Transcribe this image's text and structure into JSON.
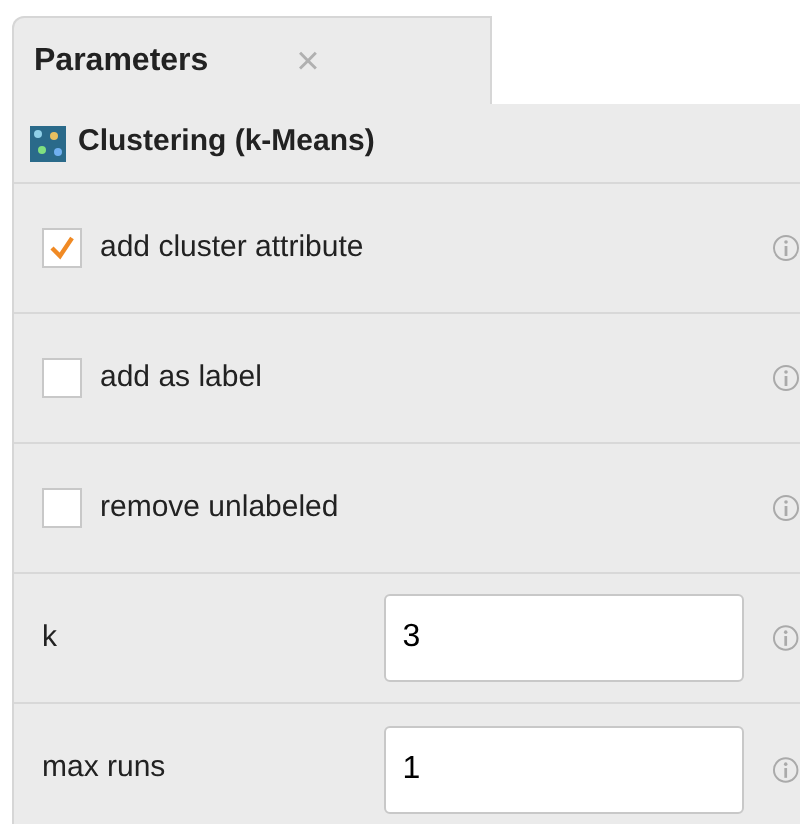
{
  "tabs": [
    {
      "label": "Parameters",
      "close": "×",
      "selected": true
    }
  ],
  "operator": {
    "title": "Clustering (k-Means)"
  },
  "parameters": [
    {
      "kind": "checkbox",
      "label": "add cluster attribute",
      "checked": true
    },
    {
      "kind": "checkbox",
      "label": "add as label",
      "checked": false
    },
    {
      "kind": "checkbox",
      "label": "remove unlabeled",
      "checked": false
    },
    {
      "kind": "number",
      "label": "k",
      "value": "3"
    },
    {
      "kind": "number",
      "label": "max runs",
      "value": "1"
    }
  ]
}
